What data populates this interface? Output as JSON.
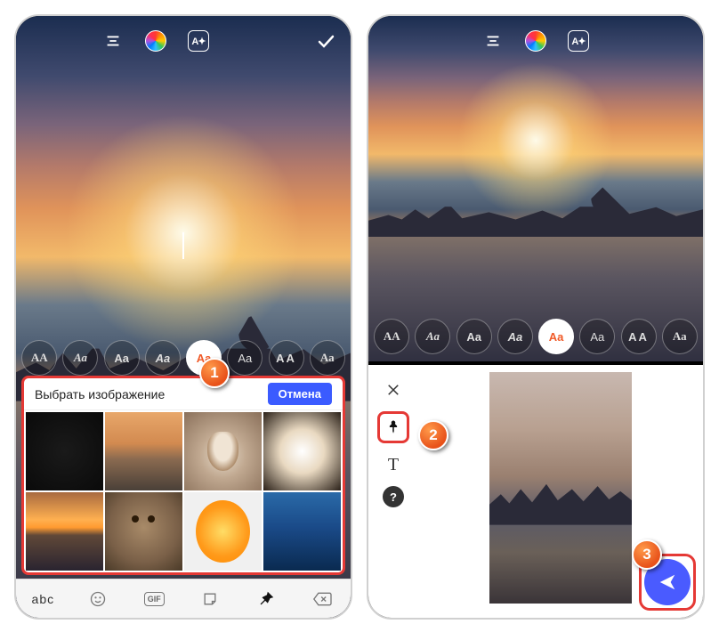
{
  "top": {
    "align_icon": "align-center",
    "color_icon": "color-wheel",
    "fx_label": "A✦",
    "confirm_icon": "checkmark"
  },
  "fonts": {
    "items": [
      {
        "label": "AA",
        "style": "serif"
      },
      {
        "label": "Aa",
        "style": "script"
      },
      {
        "label": "Aa",
        "style": "bold"
      },
      {
        "label": "Aa",
        "style": "bold-italic"
      },
      {
        "label": "Aa",
        "style": "rounded",
        "selected": true
      },
      {
        "label": "Aa",
        "style": "light"
      },
      {
        "label": "AA",
        "style": "wide"
      },
      {
        "label": "Аа",
        "style": "slab"
      }
    ]
  },
  "picker": {
    "title": "Выбрать изображение",
    "cancel": "Отмена",
    "thumbs": [
      "dark",
      "venice",
      "cat",
      "crystal-ball",
      "sunset",
      "owl",
      "orange-slice",
      "blue-water"
    ]
  },
  "keyboard_row": {
    "text_key": "abc",
    "icons": [
      "emoji",
      "gif",
      "sticker",
      "pin",
      "backspace"
    ],
    "selected": "pin",
    "gif_label": "GIF"
  },
  "editor_tools": {
    "items": [
      {
        "name": "close",
        "glyph": "×"
      },
      {
        "name": "pin",
        "glyph": "📌",
        "highlighted": true
      },
      {
        "name": "text",
        "glyph": "T"
      },
      {
        "name": "help",
        "glyph": "?"
      }
    ]
  },
  "send": {
    "icon": "send-arrow"
  },
  "callouts": {
    "b1": "1",
    "b2": "2",
    "b3": "3"
  }
}
